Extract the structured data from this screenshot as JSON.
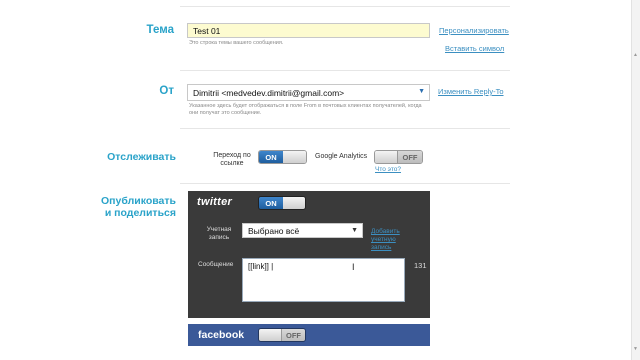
{
  "subject": {
    "label": "Тема",
    "value": "Test 01",
    "hint": "Это строка темы вашего сообщения.",
    "personalize_link": "Персонализировать",
    "insert_symbol_link": "Вставить символ"
  },
  "from": {
    "label": "От",
    "value": "Dimitrii <medvedev.dimitrii@gmail.com>",
    "hint": "Указанное здесь будет отображаться в поле From в почтовых клиентах получателей, когда они получат это сообщение.",
    "reply_to_link": "Изменить Reply-To"
  },
  "tracking": {
    "label": "Отслеживать",
    "link_clicks_label": "Переход по ссылке",
    "link_clicks_state": "ON",
    "google_analytics_label": "Google Analytics",
    "google_analytics_state": "OFF",
    "whats_this_link": "Что это?"
  },
  "share": {
    "label": "Опубликовать и поделиться",
    "twitter": {
      "logo_text": "twitter",
      "state": "ON",
      "account_label": "Учетная запись",
      "account_value": "Выбрано всё",
      "add_account_link": "Добавить учетную запись",
      "message_label": "Сообщение",
      "message_value": "[[link]] |",
      "char_count": "131"
    },
    "facebook": {
      "logo_text": "facebook",
      "state": "OFF"
    }
  },
  "colors": {
    "accent": "#2aa3c9",
    "link": "#3b8fc1",
    "subject_bg": "#fdfbd0",
    "panel_dark": "#3a3a3a",
    "facebook_blue": "#3b5998",
    "toggle_on": "#2c6fb0"
  }
}
